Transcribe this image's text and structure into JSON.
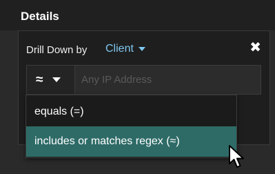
{
  "header": {
    "title": "Details"
  },
  "panel": {
    "drill_label": "Drill Down by",
    "drill_value": "Client",
    "close_symbol": "✖"
  },
  "filter": {
    "operator_symbol": "≈",
    "placeholder": "Any IP Address",
    "value": ""
  },
  "dropdown": {
    "options": [
      {
        "label": "equals (=)",
        "selected": false
      },
      {
        "label": "includes or matches regex (≈)",
        "selected": true
      }
    ]
  },
  "colors": {
    "accent": "#7ec8f0",
    "selected_option": "#2e6b67"
  },
  "icons": {
    "operator_caret": "chevron-down-icon",
    "drill_caret": "chevron-down-icon",
    "close": "close-icon",
    "cursor": "mouse-pointer-icon"
  }
}
